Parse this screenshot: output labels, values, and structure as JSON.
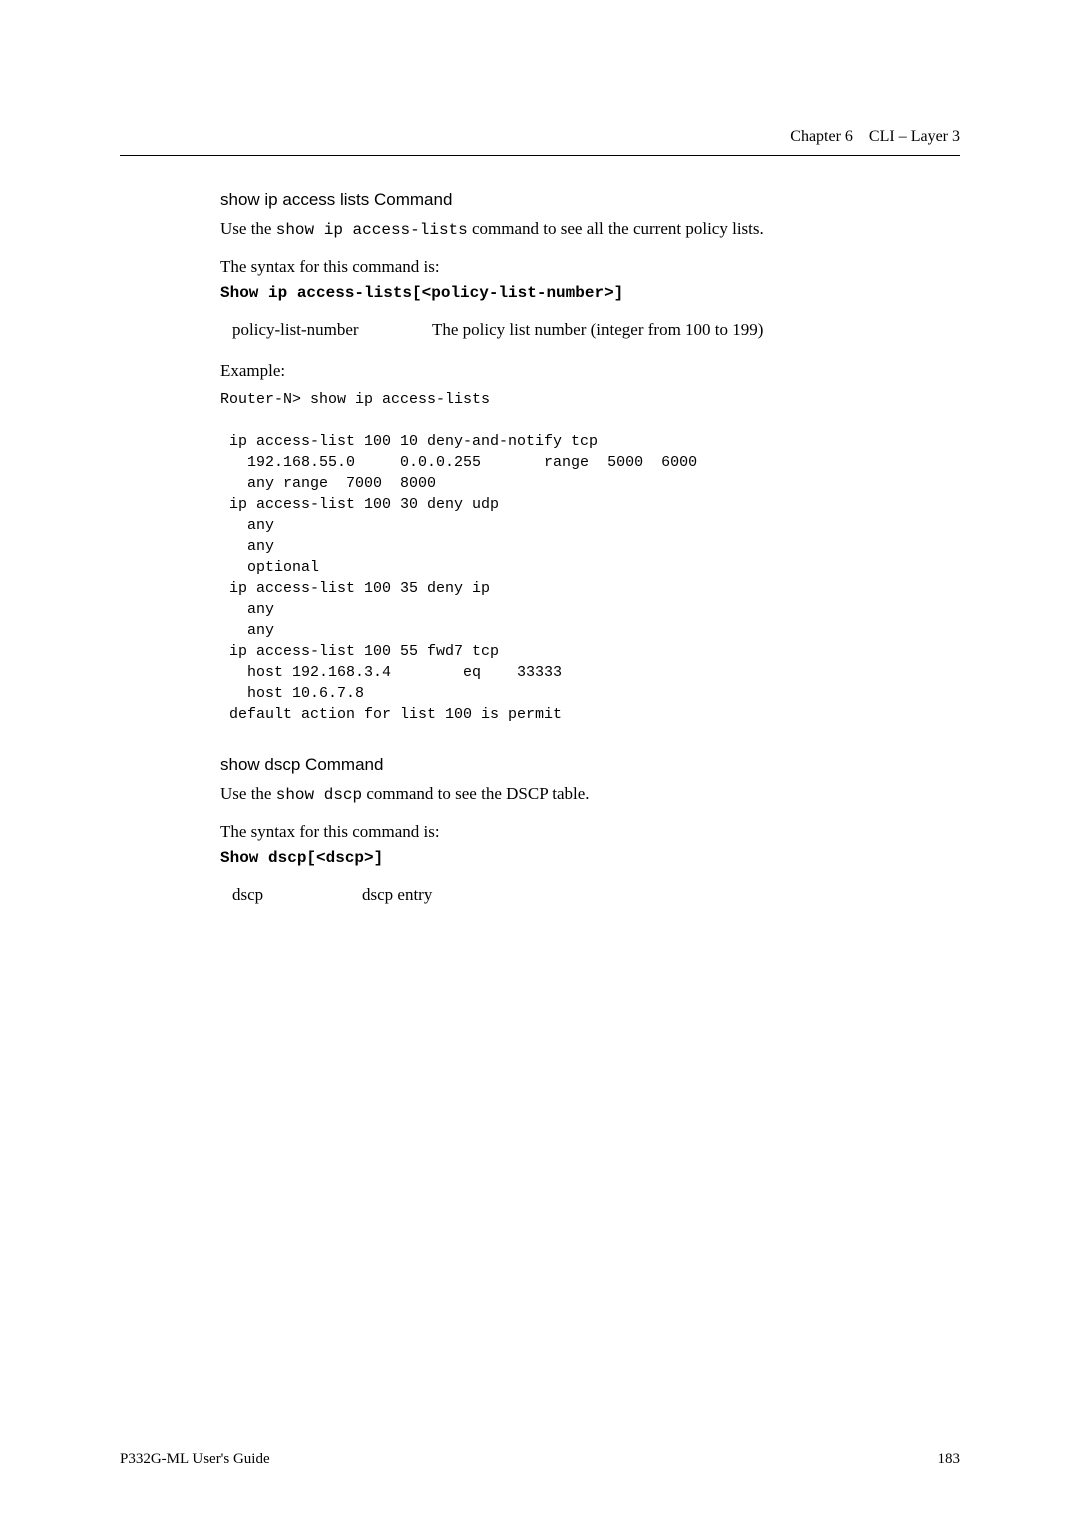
{
  "header": {
    "chapter": "Chapter 6",
    "title": "CLI – Layer 3"
  },
  "section1": {
    "title": "show ip access lists Command",
    "intro_prefix": "Use the ",
    "intro_cmd": "show ip access-lists",
    "intro_suffix": " command to see all the current policy lists.",
    "syntax_label": "The syntax for this command is:",
    "syntax_cmd": "Show ip access-lists[<policy-list-number>]",
    "param_name": "policy-list-number",
    "param_desc": "The policy list number (integer from 100 to 199)",
    "example_label": "Example:",
    "code": "Router-N> show ip access-lists\n\n ip access-list 100 10 deny-and-notify tcp\n   192.168.55.0     0.0.0.255       range  5000  6000\n   any range  7000  8000\n ip access-list 100 30 deny udp\n   any\n   any\n   optional\n ip access-list 100 35 deny ip\n   any\n   any\n ip access-list 100 55 fwd7 tcp\n   host 192.168.3.4        eq    33333\n   host 10.6.7.8\n default action for list 100 is permit"
  },
  "section2": {
    "title": "show dscp Command",
    "intro_prefix": "Use the ",
    "intro_cmd": "show dscp",
    "intro_suffix": " command to see the DSCP table.",
    "syntax_label": "The syntax for this command is:",
    "syntax_cmd": "Show dscp[<dscp>]",
    "param_name": "dscp",
    "param_desc": "dscp entry"
  },
  "footer": {
    "guide": "P332G-ML User's Guide",
    "page": "183"
  }
}
